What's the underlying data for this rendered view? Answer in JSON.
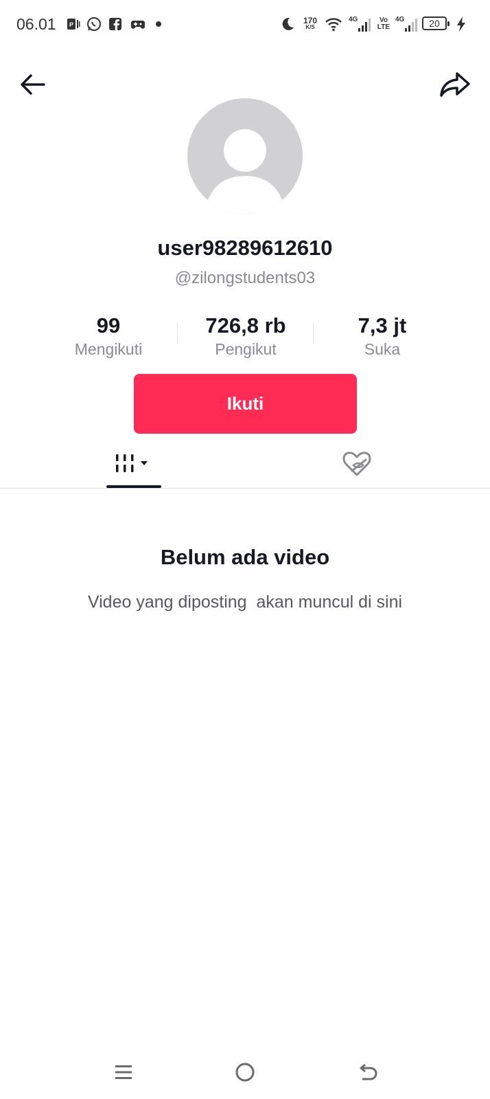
{
  "status_bar": {
    "time": "06.01",
    "net_speed_value": "170",
    "net_speed_unit": "K/S",
    "sim1": "4G",
    "volte_top": "Vo",
    "volte_bottom": "LTE",
    "sim2": "4G",
    "battery": "20"
  },
  "profile": {
    "username": "user98289612610",
    "handle": "@zilongstudents03"
  },
  "stats": [
    {
      "value": "99",
      "label": "Mengikuti"
    },
    {
      "value": "726,8 rb",
      "label": "Pengikut"
    },
    {
      "value": "7,3 jt",
      "label": "Suka"
    }
  ],
  "follow_button": "Ikuti",
  "empty_state": {
    "title": "Belum ada video",
    "description": "Video yang diposting  akan muncul di sini"
  },
  "colors": {
    "accent": "#fe2c55",
    "avatar_bg": "#d1d1d3"
  }
}
